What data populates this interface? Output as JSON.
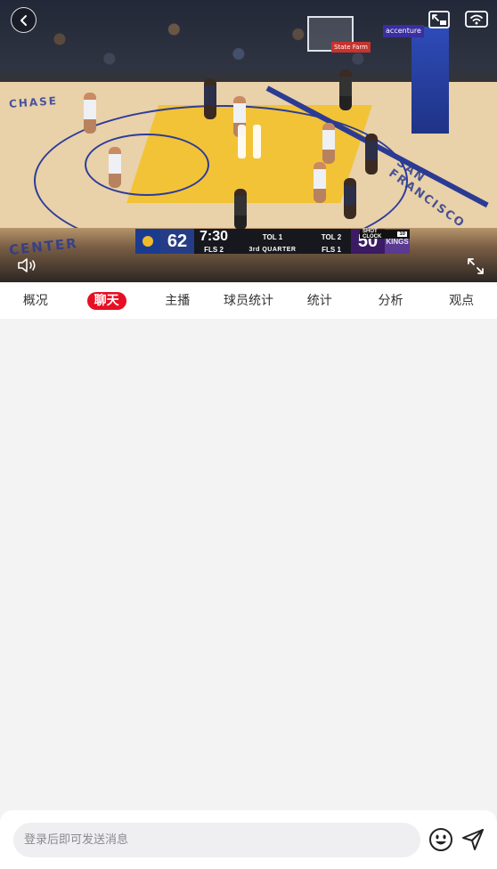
{
  "video": {
    "scoreboard": {
      "home_score": "62",
      "away_score": "50",
      "home_tol": "TOL 1",
      "home_fls": "FLS 2",
      "away_tol": "TOL 2",
      "away_fls": "FLS 1",
      "clock": "7:30",
      "quarter": "3rd QUARTER",
      "away_logo_text": "KINGS",
      "shot_clock_label": "SHOT CLOCK",
      "shot_clock_value": "10"
    },
    "court_text": {
      "center": "CENTER",
      "san_francisco": "SAN FRANCISCO",
      "baseline": "CHASE",
      "sponsor_blue": "accenture",
      "sponsor_red": "State Farm"
    },
    "icons": {
      "back": "back-arrow-icon",
      "pip": "picture-in-picture-icon",
      "cast": "cast-tv-icon",
      "pause": "pause-icon",
      "volume": "volume-icon",
      "fullscreen": "fullscreen-icon"
    }
  },
  "tabs": [
    {
      "label": "概况",
      "active": false
    },
    {
      "label": "聊天",
      "active": true
    },
    {
      "label": "主播",
      "active": false
    },
    {
      "label": "球员统计",
      "active": false
    },
    {
      "label": "统计",
      "active": false
    },
    {
      "label": "分析",
      "active": false
    },
    {
      "label": "观点",
      "active": false
    }
  ],
  "chat": {
    "input_placeholder": "登录后即可发送消息",
    "emoji_icon": "emoji-icon",
    "send_icon": "send-icon"
  },
  "colors": {
    "accent": "#e60f23",
    "page_bg": "#f3f3f4",
    "input_bg": "#efeff1"
  }
}
